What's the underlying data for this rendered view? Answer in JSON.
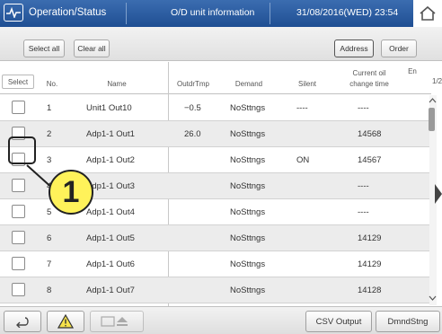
{
  "header": {
    "title": "Operation/Status",
    "subtitle": "O/D unit information",
    "datetime": "31/08/2016(WED) 23:54",
    "icon": "pulse-monitor-icon",
    "home_icon": "home-icon"
  },
  "toolbar": {
    "select_all": "Select all",
    "clear_all": "Clear all",
    "address": "Address",
    "order": "Order"
  },
  "columns": {
    "select": "Select",
    "no": "No.",
    "name": "Name",
    "outdr_tmp": "OutdrTmp",
    "demand": "Demand",
    "silent": "Silent",
    "oil_line1": "Current oil",
    "oil_line2": "change time",
    "en": "En",
    "page": "1/2"
  },
  "rows": [
    {
      "no": "1",
      "name": "Unit1 Out10",
      "tmp": "−0.5",
      "demand": "NoSttngs",
      "silent": "----",
      "oil": "----"
    },
    {
      "no": "2",
      "name": "Adp1-1 Out1",
      "tmp": "26.0",
      "demand": "NoSttngs",
      "silent": "",
      "oil": "14568"
    },
    {
      "no": "3",
      "name": "Adp1-1 Out2",
      "tmp": "",
      "demand": "NoSttngs",
      "silent": "ON",
      "oil": "14567"
    },
    {
      "no": "4",
      "name": "Adp1-1 Out3",
      "tmp": "",
      "demand": "NoSttngs",
      "silent": "",
      "oil": "----"
    },
    {
      "no": "5",
      "name": "Adp1-1 Out4",
      "tmp": "",
      "demand": "NoSttngs",
      "silent": "",
      "oil": "----"
    },
    {
      "no": "6",
      "name": "Adp1-1 Out5",
      "tmp": "",
      "demand": "NoSttngs",
      "silent": "",
      "oil": "14129"
    },
    {
      "no": "7",
      "name": "Adp1-1 Out6",
      "tmp": "",
      "demand": "NoSttngs",
      "silent": "",
      "oil": "14129"
    },
    {
      "no": "8",
      "name": "Adp1-1 Out7",
      "tmp": "",
      "demand": "NoSttngs",
      "silent": "",
      "oil": "14128"
    }
  ],
  "callout": {
    "label": "1"
  },
  "bottom": {
    "back_icon": "return-arrow-icon",
    "warning_icon": "warning-icon",
    "media_icon": "media-eject-icon",
    "csv_output": "CSV Output",
    "dmnd_stng": "DmndStng"
  }
}
